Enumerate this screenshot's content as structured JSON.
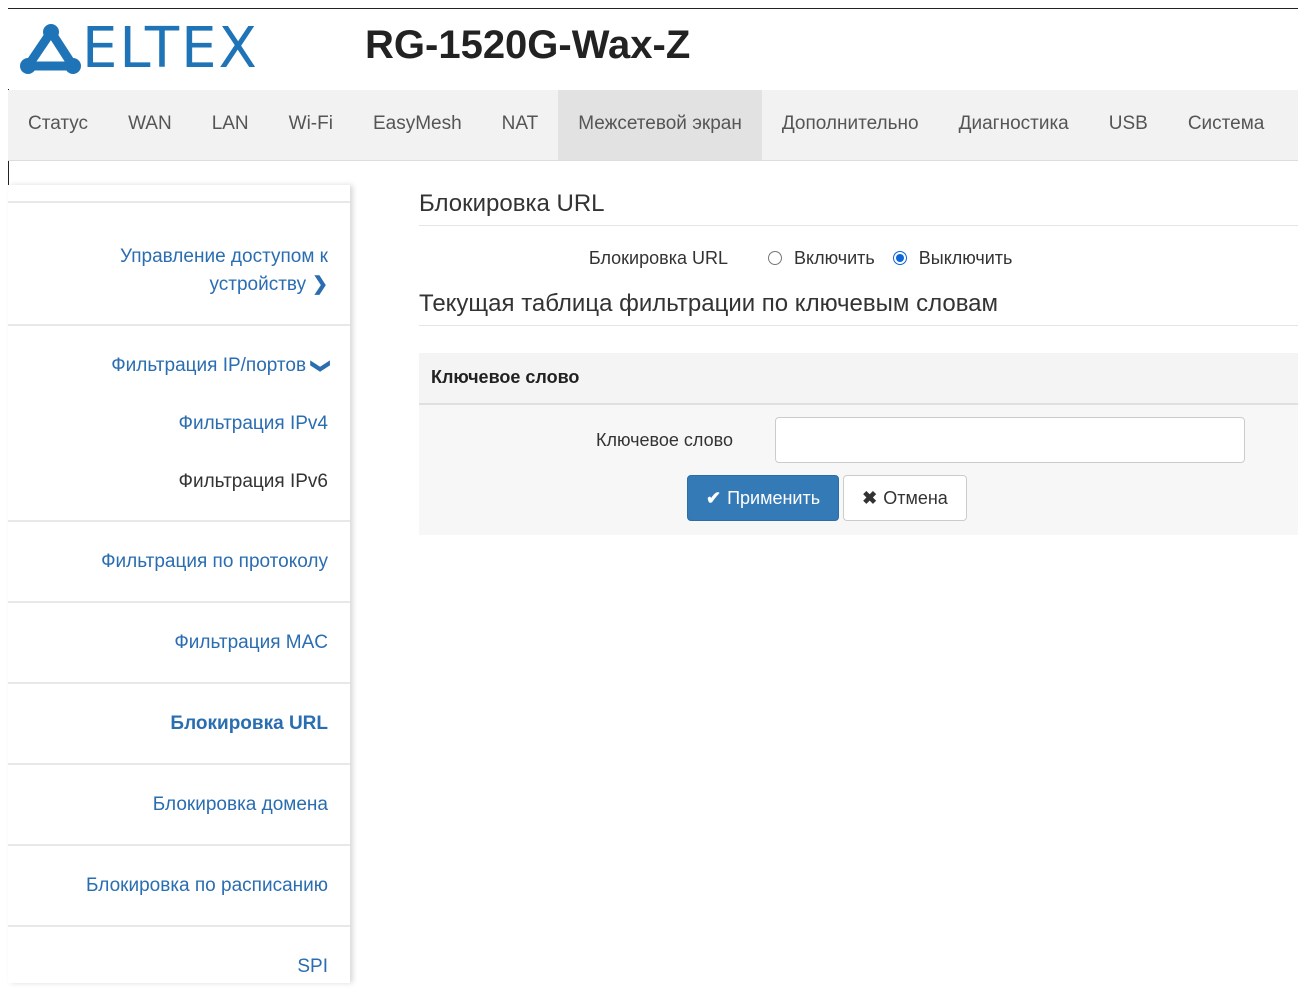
{
  "header": {
    "logo_text": "ELTEX",
    "model": "RG-1520G-Wax-Z",
    "brand_color": "#1f74b8"
  },
  "nav": {
    "items": [
      {
        "label": "Статус"
      },
      {
        "label": "WAN"
      },
      {
        "label": "LAN"
      },
      {
        "label": "Wi-Fi"
      },
      {
        "label": "EasyMesh"
      },
      {
        "label": "NAT"
      },
      {
        "label": "Межсетевой экран",
        "active": true
      },
      {
        "label": "Дополнительно"
      },
      {
        "label": "Диагностика"
      },
      {
        "label": "USB"
      },
      {
        "label": "Система"
      }
    ]
  },
  "sidebar": {
    "items": [
      {
        "label": "Управление доступом к устройству",
        "line1": "Управление доступом к",
        "line2": "устройству",
        "icon": "chevron-right-icon"
      },
      {
        "label": "Фильтрация IP/портов",
        "icon": "chevron-down-icon"
      },
      {
        "label": "Фильтрация IPv4"
      },
      {
        "label": "Фильтрация IPv6"
      },
      {
        "label": "Фильтрация по протоколу"
      },
      {
        "label": "Фильтрация MAC"
      },
      {
        "label": "Блокировка URL",
        "active": true
      },
      {
        "label": "Блокировка домена"
      },
      {
        "label": "Блокировка по расписанию"
      },
      {
        "label": "SPI"
      }
    ]
  },
  "main": {
    "section_title": "Блокировка URL",
    "url_block": {
      "label": "Блокировка URL",
      "options": [
        {
          "label": "Включить",
          "checked": false
        },
        {
          "label": "Выключить",
          "checked": true
        }
      ]
    },
    "table_title": "Текущая таблица фильтрации по ключевым словам",
    "panel_header": "Ключевое слово",
    "keyword_field": {
      "label": "Ключевое слово",
      "value": "",
      "placeholder": ""
    },
    "apply_button": "Применить",
    "cancel_button": "Отмена"
  }
}
